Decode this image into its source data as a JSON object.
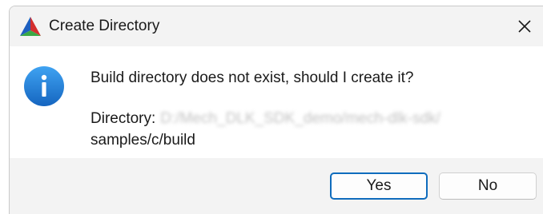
{
  "window": {
    "title": "Create Directory",
    "app_icon": "cmake-triangle-icon",
    "close_icon": "close-icon"
  },
  "message": {
    "icon": "info-icon",
    "text": "Build directory does not exist, should I create it?",
    "directory_label": "Directory:",
    "directory_path_part1": "D:/Mech_DLK_SDK_demo/mech-dlk-sdk/",
    "directory_path_part2": "samples/c/build"
  },
  "buttons": {
    "yes_label": "Yes",
    "no_label": "No"
  },
  "colors": {
    "accent": "#0f6cbd",
    "info_icon": "#1e88e5",
    "titlebar_bg": "#f3f3f3",
    "footer_bg": "#f3f3f3"
  }
}
